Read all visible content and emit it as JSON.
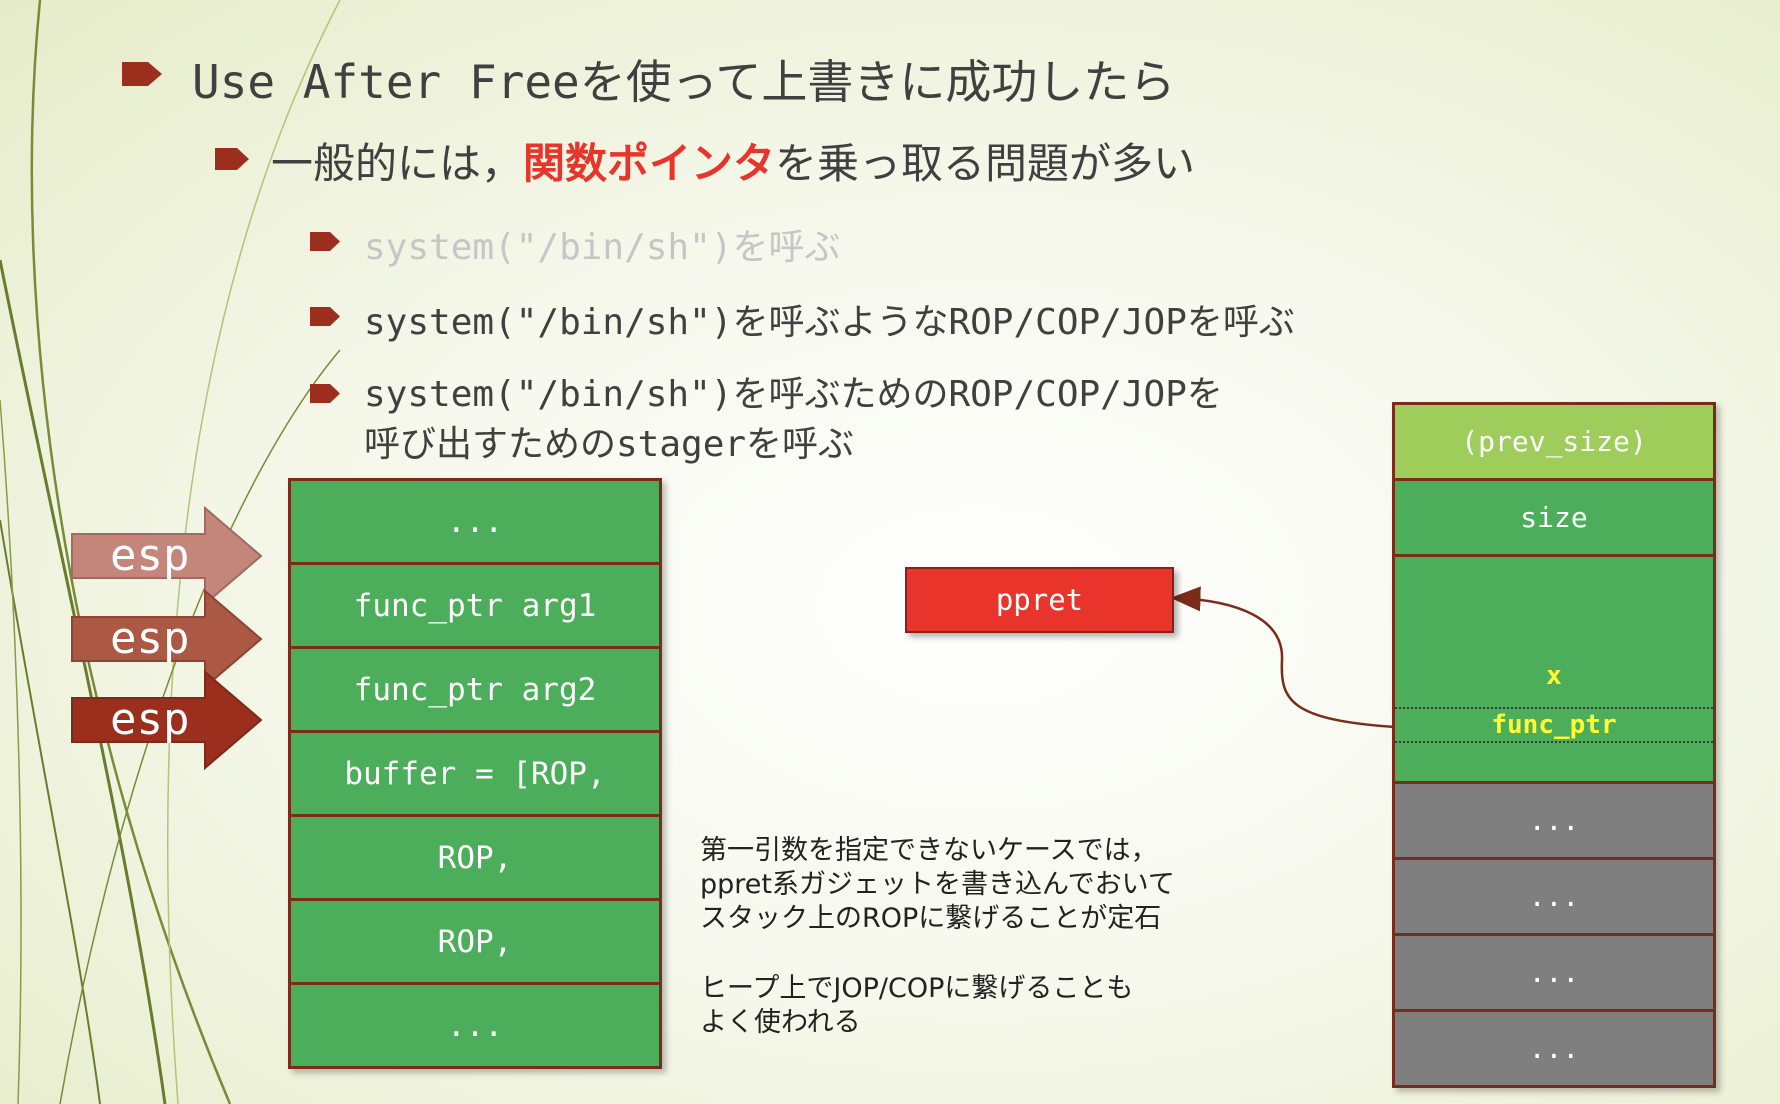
{
  "bullets": {
    "b1": {
      "text": "Use After Freeを使って上書きに成功したら"
    },
    "b2": {
      "before": "一般的には，",
      "highlight": "関数ポインタ",
      "after": "を乗っ取る問題が多い"
    },
    "b3": [
      {
        "text": "system(\"/bin/sh\")を呼ぶ"
      },
      {
        "text": "system(\"/bin/sh\")を呼ぶようなROP/COP/JOPを呼ぶ"
      },
      {
        "line1": "system(\"/bin/sh\")を呼ぶためのROP/COP/JOPを",
        "line2": "呼び出すためのstagerを呼ぶ"
      }
    ]
  },
  "stack": {
    "cells": [
      "...",
      "func_ptr arg1",
      "func_ptr arg2",
      "buffer = [ROP,",
      "ROP,",
      "ROP,",
      "..."
    ]
  },
  "esp": {
    "labels": [
      "esp",
      "esp",
      "esp"
    ]
  },
  "heap": {
    "prev_size": "(prev_size)",
    "size": "size",
    "x": "x",
    "func_ptr": "func_ptr",
    "gray_cells": [
      "...",
      "...",
      "...",
      "..."
    ]
  },
  "ppret": {
    "label": "ppret"
  },
  "notes": {
    "p1": [
      "第一引数を指定できないケースでは，",
      "ppret系ガジェットを書き込んでおいて",
      "スタック上のROPに繋げることが定石"
    ],
    "p2": [
      "ヒープ上でJOP/COPに繋げることも",
      "よく使われる"
    ]
  },
  "colors": {
    "bullet": "#9b2e1c",
    "highlight": "#e8342a",
    "cell_green": "#4cad5a",
    "cell_light_green": "#9ecd5b",
    "cell_gray": "#7f7f7f",
    "border": "#7a2c1a",
    "esp_1": "#c4857a",
    "esp_2": "#ab5845",
    "esp_3": "#9b2e1c"
  }
}
